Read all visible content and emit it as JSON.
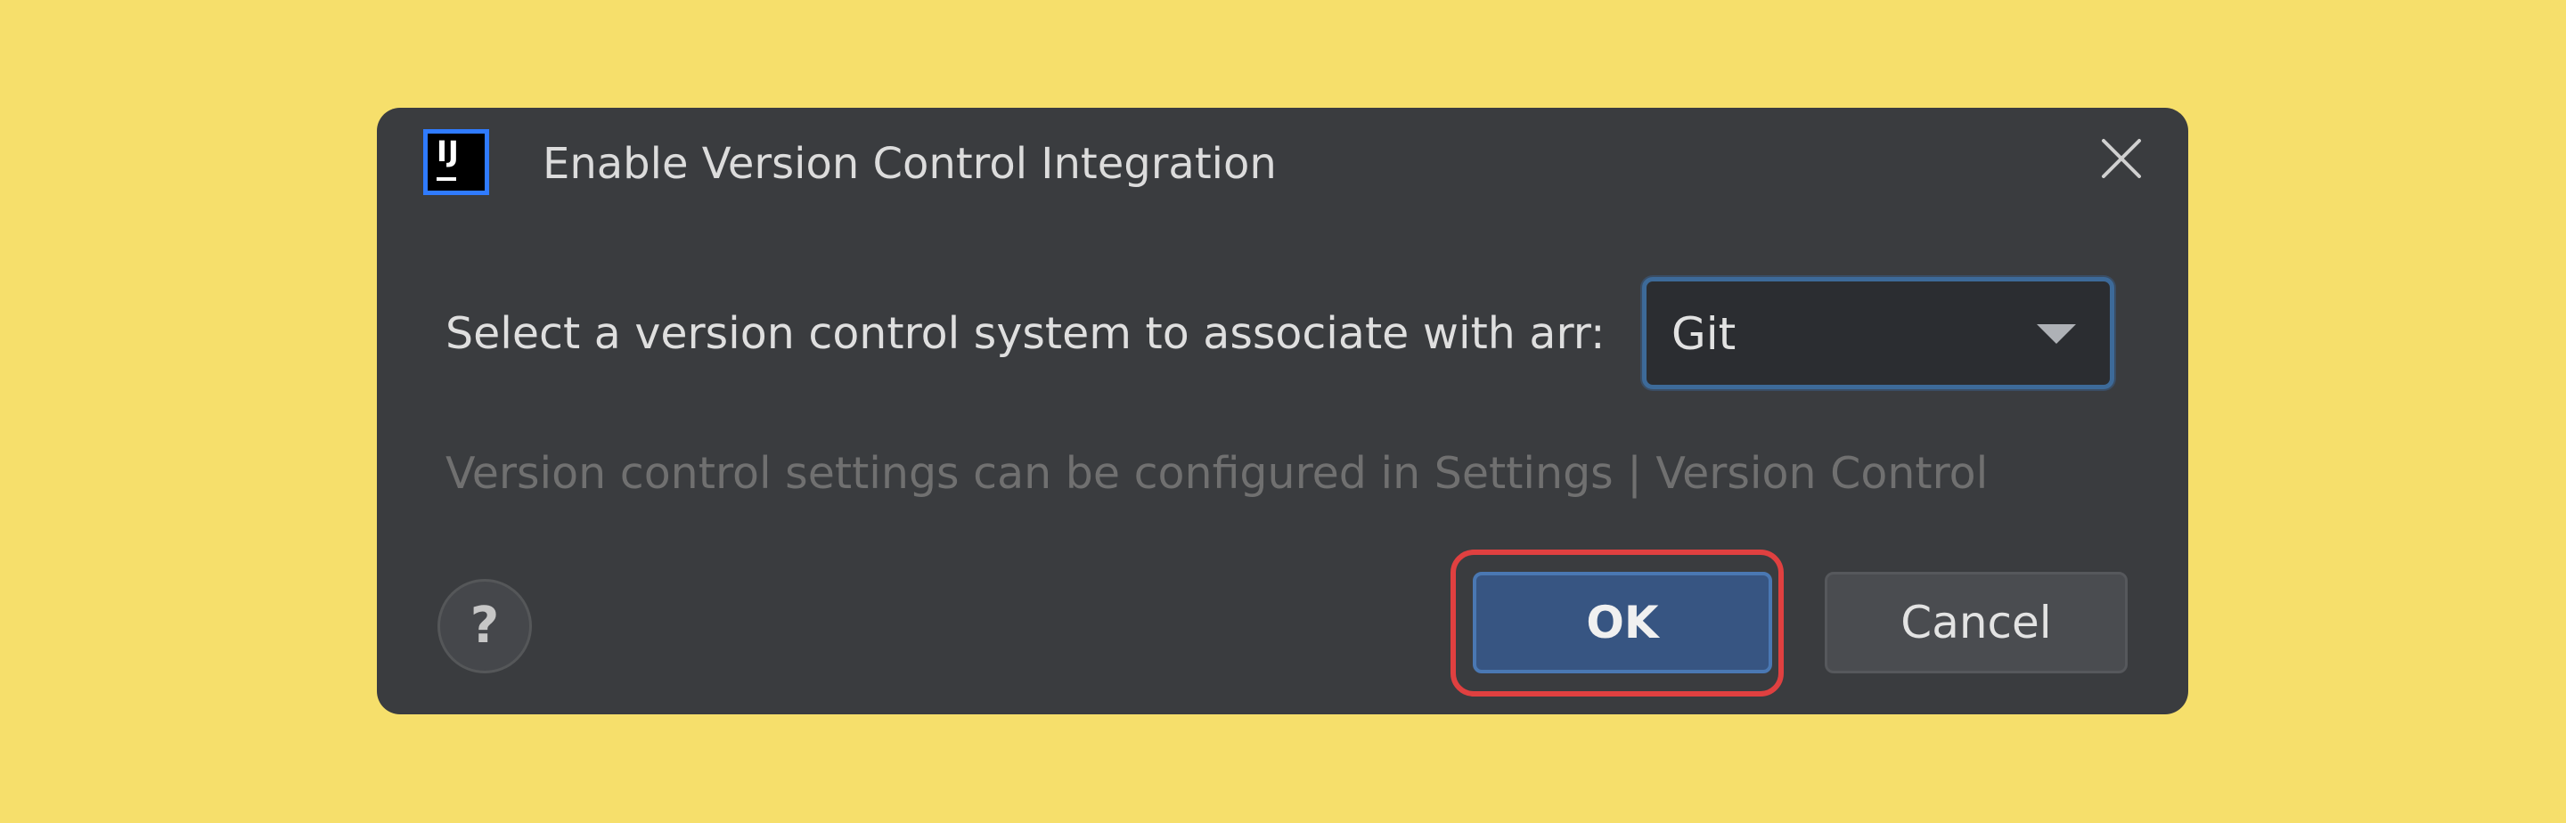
{
  "dialog": {
    "title": "Enable Version Control Integration",
    "app_icon_text": "IJ",
    "prompt": "Select a version control system to associate with arr:",
    "vcs_select": {
      "selected": "Git"
    },
    "hint": "Version control settings can be configured in Settings | Version Control",
    "buttons": {
      "help": "?",
      "ok": "OK",
      "cancel": "Cancel"
    }
  },
  "colors": {
    "background": "#f6df6b",
    "dialog_bg": "#3a3c3f",
    "primary_button": "#375582",
    "highlight": "#e04040"
  },
  "icons": {
    "app": "intellij-idea-icon",
    "close": "close-icon",
    "dropdown": "chevron-down-icon",
    "help": "help-icon"
  }
}
